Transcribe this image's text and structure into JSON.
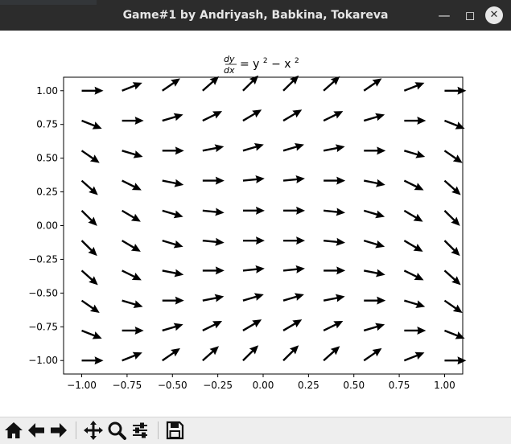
{
  "window": {
    "title": "Game#1 by Andriyash, Babkina, Tokareva"
  },
  "toolbar": {
    "buttons": [
      "home-icon",
      "back-icon",
      "forward-icon",
      "pan-icon",
      "zoom-icon",
      "configure-subplots-icon",
      "save-icon"
    ]
  },
  "chart_data": {
    "type": "quiver",
    "title": "dy/dx = y^2 - x^2",
    "title_parts": {
      "num": "dy",
      "den": "dx",
      "rhs_a": "= y",
      "exp_a": "2",
      "rhs_b": " − x",
      "exp_b": "2"
    },
    "equation": {
      "dx": 1,
      "dy": "y^2 - x^2",
      "normalized": true
    },
    "grid": {
      "x_start": -1.0,
      "x_end": 1.0,
      "y_start": -1.0,
      "y_end": 1.0,
      "count": 10
    },
    "xlim": [
      -1.1,
      1.1
    ],
    "ylim": [
      -1.1,
      1.1
    ],
    "xticks": [
      -1.0,
      -0.75,
      -0.5,
      -0.25,
      0.0,
      0.25,
      0.5,
      0.75,
      1.0
    ],
    "xtick_labels": [
      "−1.00",
      "−0.75",
      "−0.50",
      "−0.25",
      "0.00",
      "0.25",
      "0.50",
      "0.75",
      "1.00"
    ],
    "yticks": [
      -1.0,
      -0.75,
      -0.5,
      -0.25,
      0.0,
      0.25,
      0.5,
      0.75,
      1.0
    ],
    "ytick_labels": [
      "−1.00",
      "−0.75",
      "−0.50",
      "−0.25",
      "0.00",
      "0.25",
      "0.50",
      "0.75",
      "1.00"
    ],
    "xlabel": "",
    "ylabel": "",
    "grid_lines": false,
    "arrow_color": "#000000"
  }
}
